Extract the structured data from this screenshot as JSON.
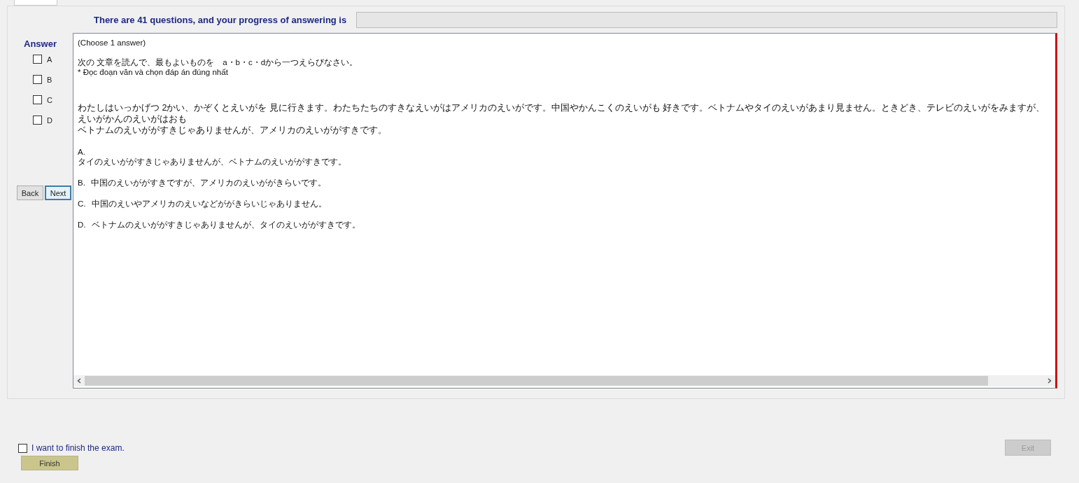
{
  "header": {
    "text": "There are 41 questions, and your progress of answering is",
    "progress": {
      "level": 0
    }
  },
  "answer": {
    "title": "Answer",
    "options": [
      {
        "label": "A",
        "checked": false
      },
      {
        "label": "B",
        "checked": false
      },
      {
        "label": "C",
        "checked": false
      },
      {
        "label": "D",
        "checked": false
      }
    ]
  },
  "nav_buttons": [
    {
      "label": "Back",
      "selected": false
    },
    {
      "label": "Next",
      "selected": true
    }
  ],
  "question": {
    "instruction": "(Choose 1 answer)",
    "prompt": [
      "次の 文章を読んで、最もよいものを　a・b・c・dから一つえらびなさい。",
      "* Đọc đoạn văn và chọn đáp án đúng nhất"
    ],
    "passage": [
      "わたしはいっかげつ 2かい、かぞくとえいがを 見に行きます。わたちたちのすきなえいがはアメリカのえいがです。中国やかんこくのえいがも 好きです。ベトナムやタイのえいがあまり見ません。ときどき、テレビのえいがをみますが、えいがかんのえいがはおも",
      "ベトナムのえいががすきじゃありませんが、アメリカのえいががすきです。"
    ],
    "choices": [
      {
        "letter": "A.",
        "text": "タイのえいががすきじゃありませんが、ベトナムのえいががすきです。",
        "kind": "wrapped"
      },
      {
        "letter": "B.",
        "text": "中国のえいががすきですが、アメリカのえいががきらいです。",
        "kind": "inline"
      },
      {
        "letter": "C.",
        "text": "中国のえいやアメリカのえいなどががきらいじゃありません。",
        "kind": "inline"
      },
      {
        "letter": "D.",
        "text": "ベトナムのえいががすきじゃありませんが、タイのえいががすきです。",
        "kind": "inline"
      }
    ]
  },
  "footer": {
    "finish_check": {
      "label": "I want to finish the exam.",
      "checked": false
    },
    "finish_button": {
      "label": "Finish",
      "disabled": false
    },
    "exit_button": {
      "label": "Exit",
      "disabled": true
    }
  }
}
